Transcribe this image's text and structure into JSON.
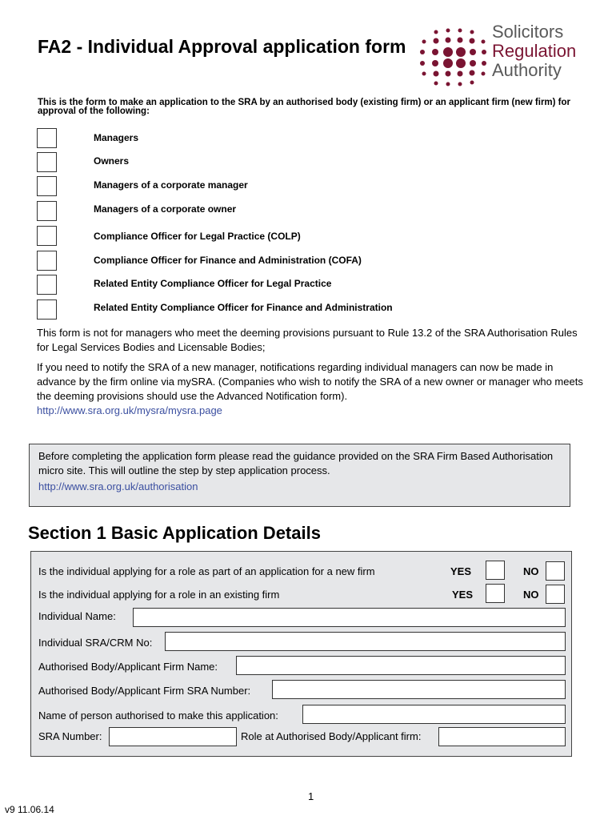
{
  "header": {
    "title": "FA2 - Individual Approval application form",
    "logo": {
      "line1": "Solicitors",
      "line2": "Regulation",
      "line3": "Authority",
      "brand_color": "#7a1432"
    }
  },
  "intro": "This is the form to make an application to the SRA by an authorised body (existing firm) or an applicant firm (new firm) for approval of the following:",
  "approval_types": [
    {
      "label": "Managers",
      "checked": false
    },
    {
      "label": "Owners",
      "checked": false
    },
    {
      "label": "Managers of a corporate manager",
      "checked": false
    },
    {
      "label": "Managers of a corporate owner",
      "checked": false
    },
    {
      "label": "Compliance Officer for Legal Practice (COLP)",
      "checked": false
    },
    {
      "label": "Compliance Officer for Finance and Administration (COFA)",
      "checked": false
    },
    {
      "label": "Related Entity Compliance Officer for Legal Practice",
      "checked": false
    },
    {
      "label": "Related Entity Compliance Officer for Finance and Administration",
      "checked": false
    }
  ],
  "notes": {
    "deeming": "This form is not for managers who meet the deeming provisions pursuant to Rule 13.2 of the SRA Authorisation Rules for Legal Services Bodies and Licensable Bodies;",
    "notify": "If you need to notify the SRA of a new manager, notifications regarding individual managers can now be made in advance by the firm online via mySRA.  (Companies who wish to notify the SRA of a new owner or manager who meets the deeming provisions should use the Advanced Notification form).",
    "mysra_link": "http://www.sra.org.uk/mysra/mysra.page"
  },
  "guidance": {
    "text": "Before completing the application form please read the guidance provided on the SRA Firm Based Authorisation micro site. This will outline the step by step application process.",
    "link": "http://www.sra.org.uk/authorisation"
  },
  "section1": {
    "title": "Section 1  Basic Application Details",
    "questions": [
      {
        "text": "Is the individual applying for a role as part of an application for a new firm",
        "yes_label": "YES",
        "no_label": "NO"
      },
      {
        "text": "Is the individual applying for a role in an existing firm",
        "yes_label": "YES",
        "no_label": "NO"
      }
    ],
    "fields": {
      "individual_name": {
        "label": "Individual Name:",
        "value": ""
      },
      "sra_crm_no": {
        "label": "Individual SRA/CRM No:",
        "value": ""
      },
      "firm_name": {
        "label": "Authorised Body/Applicant Firm Name:",
        "value": ""
      },
      "firm_sra_number": {
        "label": "Authorised Body/Applicant Firm SRA Number:",
        "value": ""
      },
      "authorised_person": {
        "label": "Name of person authorised to make this application:",
        "value": ""
      },
      "sra_number": {
        "label": "SRA Number:",
        "value": ""
      },
      "role": {
        "label": "Role at Authorised Body/Applicant firm:",
        "value": ""
      }
    }
  },
  "footer": {
    "page_number": "1",
    "version": "v9 11.06.14"
  }
}
